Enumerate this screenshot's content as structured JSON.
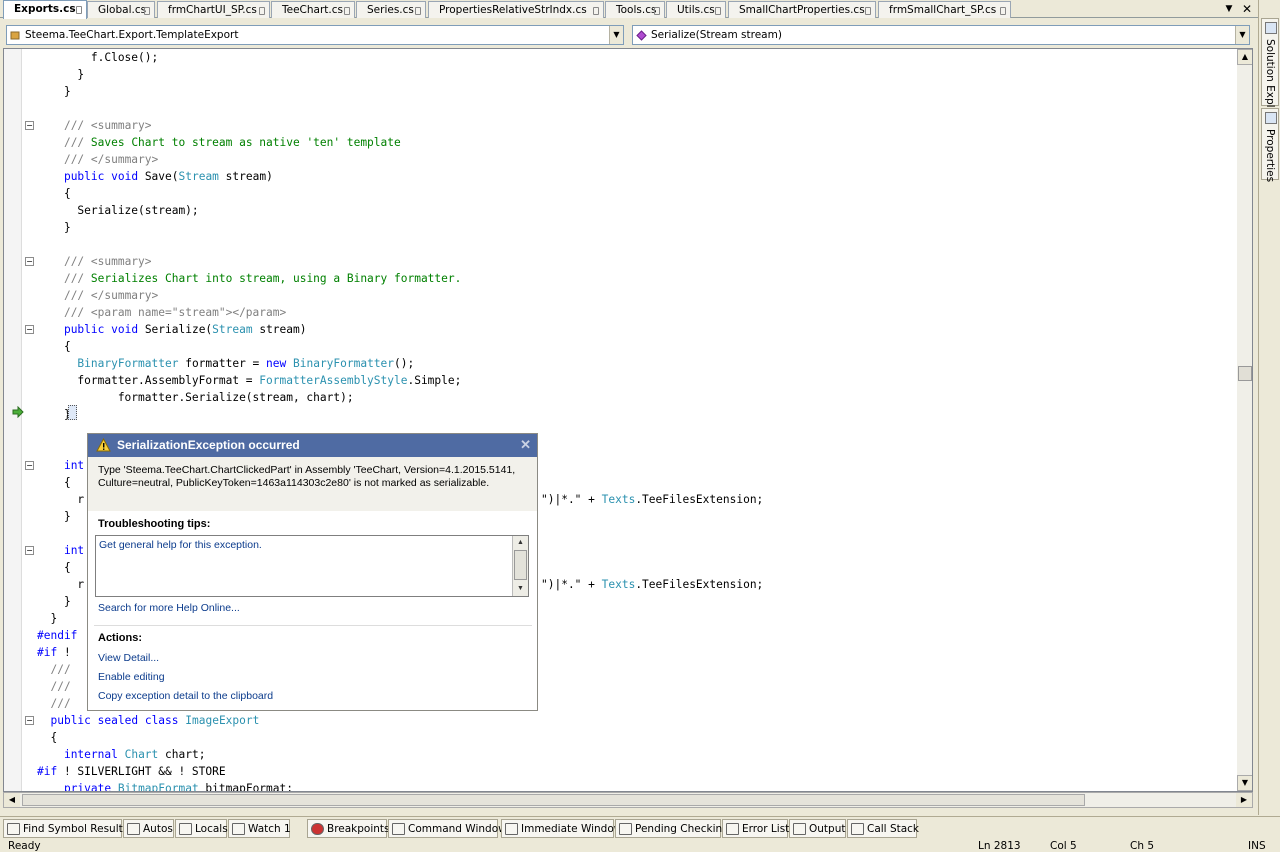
{
  "tabs": [
    {
      "label": "Exports.cs",
      "active": true
    },
    {
      "label": "Global.cs",
      "active": false
    },
    {
      "label": "frmChartUI_SP.cs",
      "active": false
    },
    {
      "label": "TeeChart.cs",
      "active": false
    },
    {
      "label": "Series.cs",
      "active": false
    },
    {
      "label": "PropertiesRelativeStrIndx.cs",
      "active": false
    },
    {
      "label": "Tools.cs",
      "active": false
    },
    {
      "label": "Utils.cs",
      "active": false
    },
    {
      "label": "SmallChartProperties.cs",
      "active": false
    },
    {
      "label": "frmSmallChart_SP.cs",
      "active": false
    }
  ],
  "tab_controls": {
    "dropdown": "▼",
    "close": "✕"
  },
  "navbar": {
    "class_combo": "Steema.TeeChart.Export.TemplateExport",
    "member_combo": "Serialize(Stream stream)"
  },
  "side_panels": [
    "Solution Explorer",
    "Properties"
  ],
  "code_lines": [
    "        f.Close();",
    "      }",
    "    }",
    "",
    "    /// <summary>",
    "    /// Saves Chart to stream as native 'ten' template",
    "    /// </summary>",
    "    public void Save(Stream stream)",
    "    {",
    "      Serialize(stream);",
    "    }",
    "",
    "    /// <summary>",
    "    /// Serializes Chart into stream, using a Binary formatter.",
    "    /// </summary>",
    "    /// <param name=\"stream\"></param>",
    "    public void Serialize(Stream stream)",
    "    {",
    "      BinaryFormatter formatter = new BinaryFormatter();",
    "      formatter.AssemblyFormat = FormatterAssemblyStyle.Simple;",
    "            formatter.Serialize(stream, chart);",
    "    }",
    "",
    "",
    "    int",
    "    {",
    "      r",
    "    }",
    "",
    "    int",
    "    {",
    "      r",
    "    }",
    "  }",
    "#endif",
    "#if ! ",
    "  ///",
    "  ///",
    "  ///",
    "  public sealed class ImageExport",
    "  {",
    "    internal Chart chart;",
    "#if ! SILVERLIGHT && ! STORE",
    "    private BitmapFormat bitmapFormat;"
  ],
  "code_tails": {
    "line26": "\")|*.\" + Texts.TeeFilesExtension;",
    "line31": "\")|*.\" + Texts.TeeFilesExtension;"
  },
  "exception": {
    "title": "SerializationException occurred",
    "message": "Type 'Steema.TeeChart.ChartClickedPart' in Assembly 'TeeChart, Version=4.1.2015.5141, Culture=neutral, PublicKeyToken=1463a114303c2e80' is not marked as serializable.",
    "tips_heading": "Troubleshooting tips:",
    "tip": "Get general help for this exception.",
    "search_link": "Search for more Help Online...",
    "actions_heading": "Actions:",
    "actions": [
      "View Detail...",
      "Enable editing",
      "Copy exception detail to the clipboard"
    ],
    "close": "✕"
  },
  "bottom_tabs": [
    "Find Symbol Results",
    "Autos",
    "Locals",
    "Watch 1",
    "Breakpoints",
    "Command Window",
    "Immediate Window",
    "Pending Checkins",
    "Error List",
    "Output",
    "Call Stack"
  ],
  "status": {
    "ready": "Ready",
    "ln": "Ln 2813",
    "col": "Col 5",
    "ch": "Ch 5",
    "mode": "INS"
  },
  "colors": {
    "keyword": "#0000ff",
    "comment": "#008000",
    "type": "#2b91af",
    "popup_header": "#4f6ba3"
  }
}
